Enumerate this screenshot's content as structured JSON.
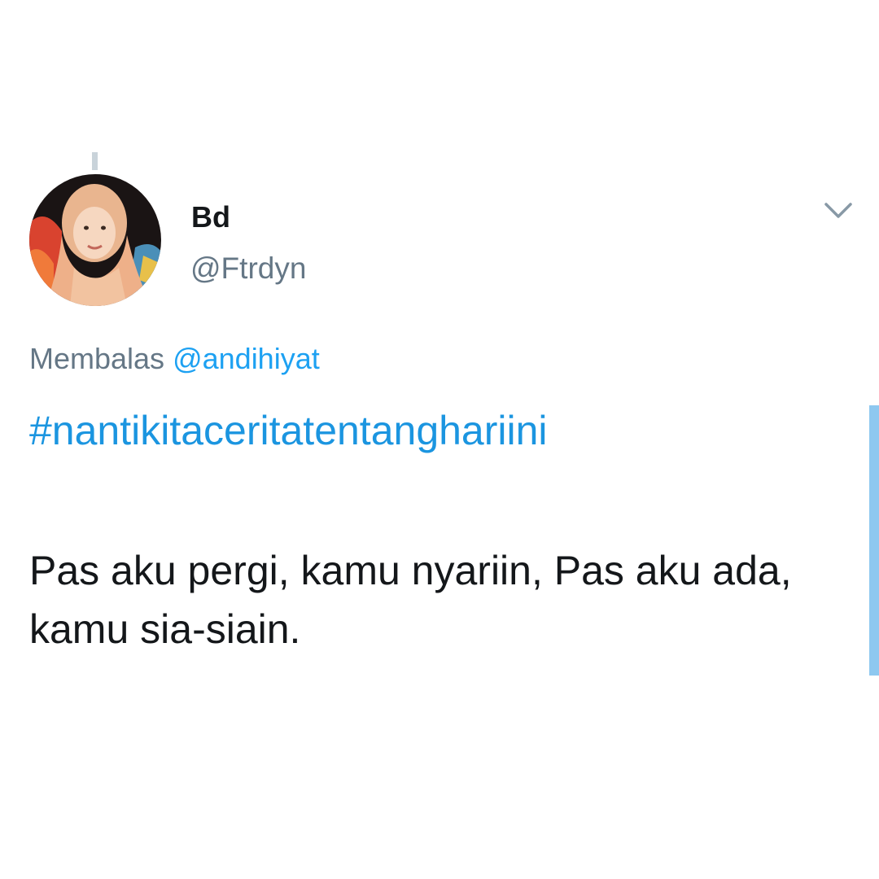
{
  "tweet": {
    "display_name": "Bd",
    "handle": "@Ftrdyn",
    "reply_prefix": "Membalas",
    "reply_to": "@andihiyat",
    "hashtag": "#nantikitaceritatentanghariini",
    "text": "Pas aku pergi, kamu nyariin, Pas aku ada, kamu sia-siain."
  },
  "icons": {
    "menu": "chevron-down-icon"
  },
  "colors": {
    "link": "#1b95e0",
    "secondary_text": "#657786",
    "primary_text": "#14171a",
    "scroll_indicator": "#8ec8f0"
  }
}
